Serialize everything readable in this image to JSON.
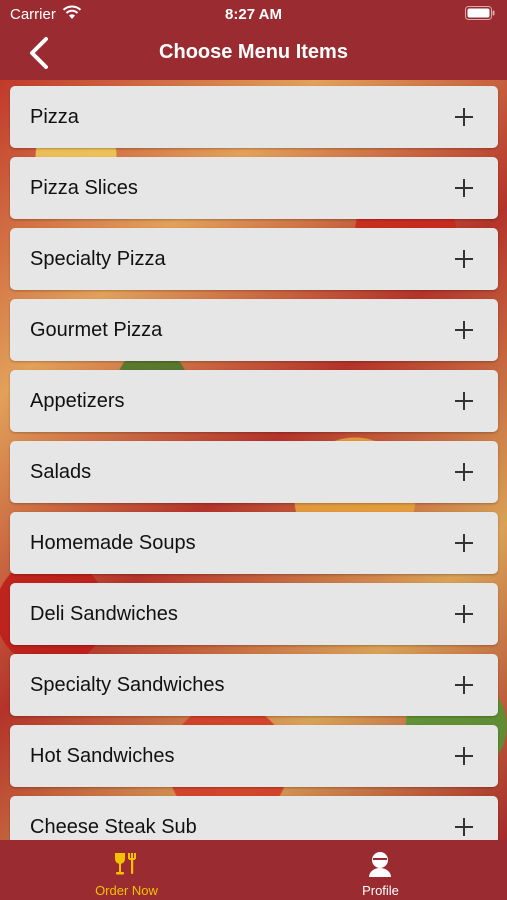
{
  "status_bar": {
    "carrier": "Carrier",
    "time": "8:27 AM"
  },
  "header": {
    "title": "Choose Menu Items",
    "back_icon": "chevron-left-icon"
  },
  "menu_items": [
    {
      "label": "Pizza"
    },
    {
      "label": "Pizza Slices"
    },
    {
      "label": "Specialty Pizza"
    },
    {
      "label": "Gourmet Pizza"
    },
    {
      "label": "Appetizers"
    },
    {
      "label": "Salads"
    },
    {
      "label": "Homemade Soups"
    },
    {
      "label": "Deli Sandwiches"
    },
    {
      "label": "Specialty Sandwiches"
    },
    {
      "label": "Hot Sandwiches"
    },
    {
      "label": "Cheese Steak Sub"
    }
  ],
  "tab_bar": {
    "tabs": [
      {
        "label": "Order Now",
        "icon": "utensils-icon",
        "active": true
      },
      {
        "label": "Profile",
        "icon": "person-icon",
        "active": false
      }
    ]
  },
  "colors": {
    "brand": "#9a2c31",
    "active_tab": "#f2c200",
    "item_bg": "#e6e6e6"
  }
}
